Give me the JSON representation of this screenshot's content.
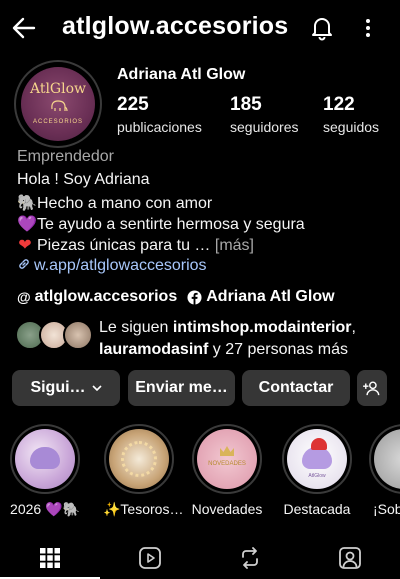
{
  "header": {
    "username": "atlglow.accesorios"
  },
  "profile": {
    "avatar_text": "AtlGlow",
    "avatar_subtext": "ACCESORIOS",
    "display_name": "Adriana Atl Glow",
    "stats": [
      {
        "value": "225",
        "label": "publicaciones"
      },
      {
        "value": "185",
        "label": "seguidores"
      },
      {
        "value": "122",
        "label": "seguidos"
      }
    ],
    "category": "Emprendedor",
    "bio": [
      {
        "emoji": "",
        "text": "Hola ! Soy Adriana"
      },
      {
        "emoji": "🐘",
        "text": "Hecho a mano con amor"
      },
      {
        "emoji": "💜",
        "text": "Te ayudo a sentirte hermosa y segura"
      },
      {
        "emoji": "❤",
        "text": "Piezas únicas para tu … "
      }
    ],
    "more_label": "[más]",
    "link": "w.app/atlglowaccesorios",
    "threads_handle": "atlglow.accesorios",
    "facebook_name": "Adriana Atl Glow",
    "followed_by": {
      "prefix": "Le siguen ",
      "user1": "intimshop.modainterior",
      "separator": ",",
      "user2": "lauramodasinf",
      "suffix": " y 27 personas más"
    }
  },
  "actions": {
    "follow_label": "Sigui…",
    "message_label": "Enviar me…",
    "contact_label": "Contactar"
  },
  "highlights": [
    {
      "label": "2026 💜🐘",
      "img_text": ""
    },
    {
      "label": "✨Tesoros…",
      "img_text": ""
    },
    {
      "label": "Novedades",
      "img_text": "NOVEDADES"
    },
    {
      "label": "Destacada",
      "img_text": "AtlGlow"
    },
    {
      "label": "¡Sob",
      "img_text": ""
    }
  ],
  "icons": {
    "back": "back-arrow-icon",
    "bell": "bell-icon",
    "more": "more-vertical-icon",
    "grid": "grid-icon",
    "reels": "reels-icon",
    "repost": "repost-icon",
    "tagged": "tagged-icon"
  }
}
